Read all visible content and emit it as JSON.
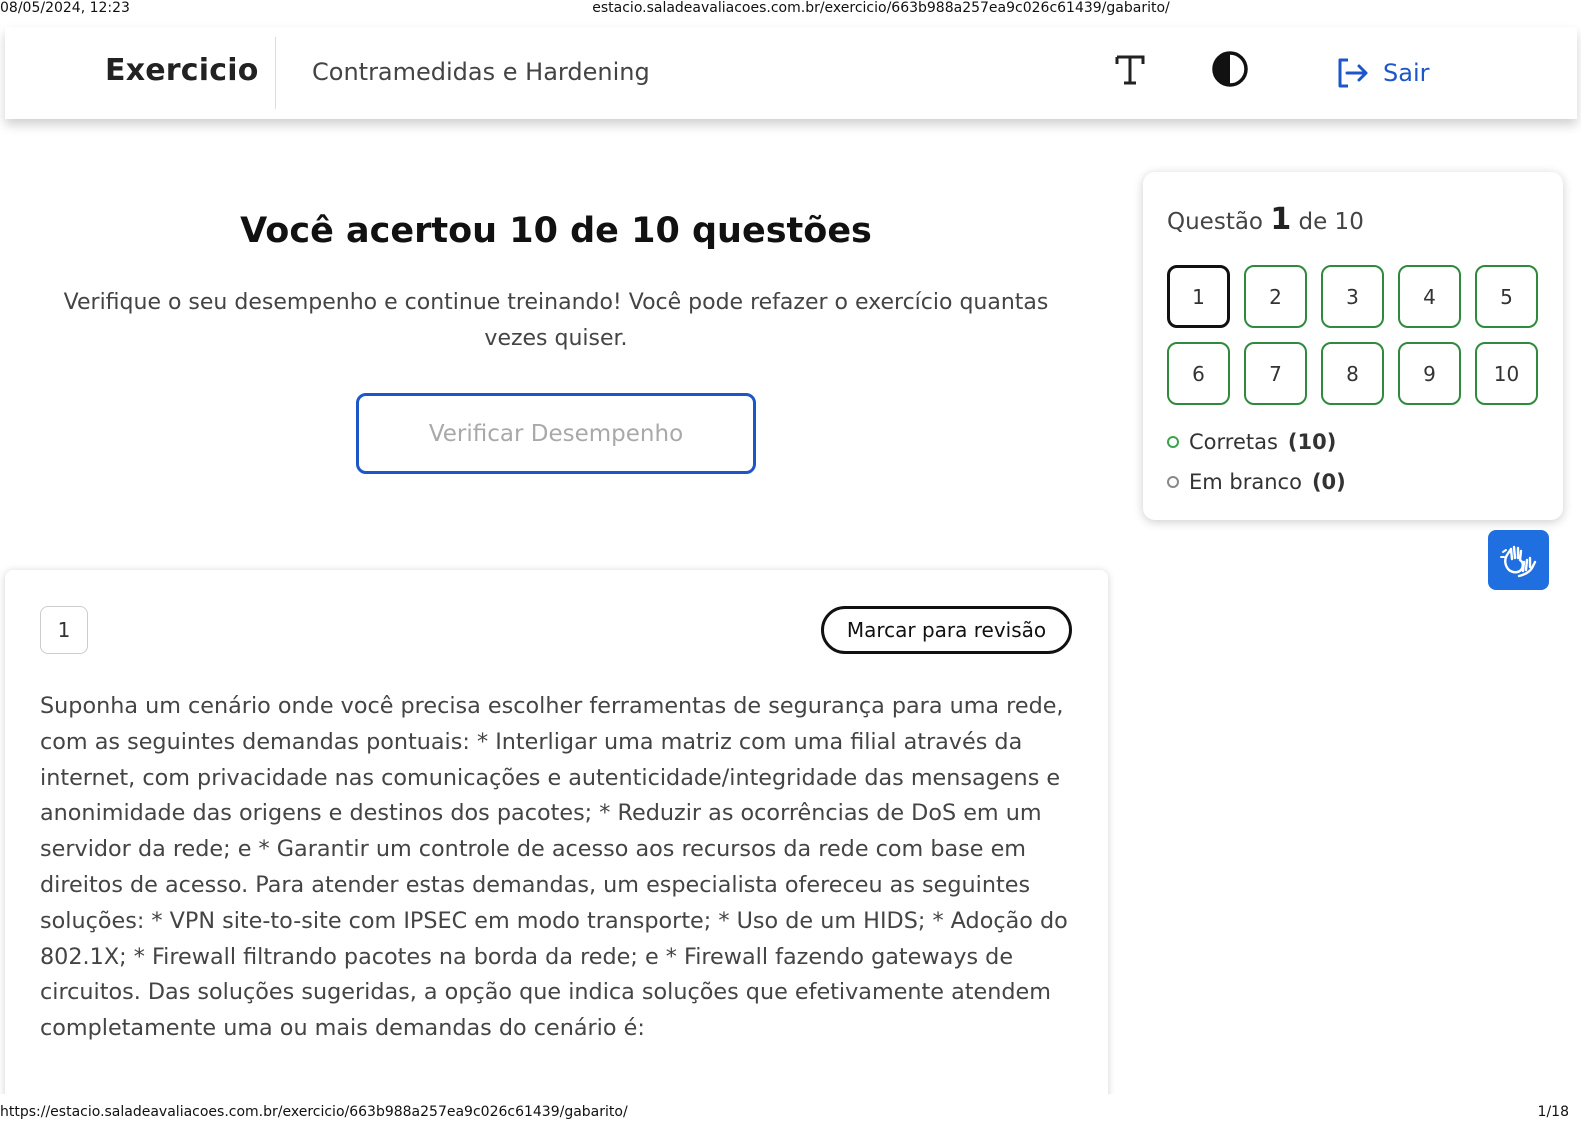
{
  "print": {
    "datetime": "08/05/2024, 12:23",
    "url_top": "estacio.saladeavaliacoes.com.br/exercicio/663b988a257ea9c026c61439/gabarito/",
    "url_bottom": "https://estacio.saladeavaliacoes.com.br/exercicio/663b988a257ea9c026c61439/gabarito/",
    "page": "1/18"
  },
  "header": {
    "brand": "Exercicio",
    "subject": "Contramedidas e Hardening",
    "logout_label": "Sair",
    "icons": [
      "font-size-icon",
      "contrast-icon",
      "logout-icon"
    ]
  },
  "result": {
    "title": "Você acertou 10 de 10 questões",
    "description": "Verifique o seu desempenho e continue treinando! Você pode refazer o exercício quantas vezes quiser.",
    "verify_button": "Verificar Desempenho"
  },
  "navigator": {
    "prefix": "Questão",
    "current": "1",
    "suffix": "de 10",
    "questions": [
      "1",
      "2",
      "3",
      "4",
      "5",
      "6",
      "7",
      "8",
      "9",
      "10"
    ],
    "correct_label": "Corretas",
    "correct_count": "(10)",
    "blank_label": "Em branco",
    "blank_count": "(0)",
    "colors": {
      "correct": "#2f8a3e",
      "current": "#111111",
      "accent": "#1d56c9"
    }
  },
  "question": {
    "number": "1",
    "review_button": "Marcar para revisão",
    "text": "Suponha um cenário onde você precisa escolher ferramentas de segurança para uma rede, com as seguintes demandas pontuais: * Interligar uma matriz com uma filial através da internet, com privacidade nas comunicações e autenticidade/integridade das mensagens e anonimidade das origens e destinos dos pacotes; * Reduzir as ocorrências de DoS em um servidor da rede; e * Garantir um controle de acesso aos recursos da rede com base em direitos de acesso. Para atender estas demandas, um especialista ofereceu as seguintes soluções: * VPN site-to-site com IPSEC em modo transporte; * Uso de um HIDS; * Adoção do 802.1X; * Firewall filtrando pacotes na borda da rede; e * Firewall fazendo gateways de circuitos. Das soluções sugeridas, a opção que indica soluções que efetivamente atendem completamente uma ou mais demandas do cenário é:"
  }
}
